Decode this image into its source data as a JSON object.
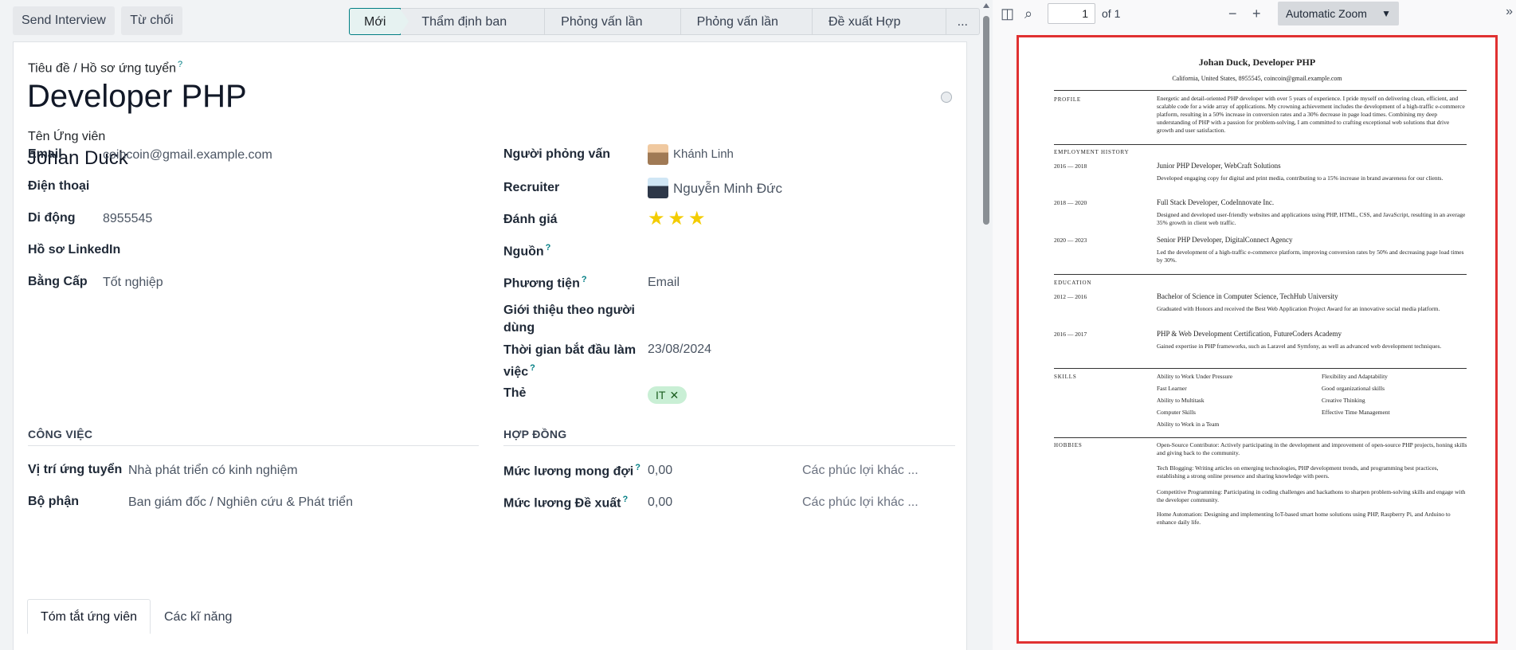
{
  "toolbar": {
    "send_interview": "Send Interview",
    "refuse": "Từ chối"
  },
  "stages": [
    "Mới",
    "Thẩm định ban đầu",
    "Phỏng vấn lần đầu",
    "Phỏng vấn lần hai",
    "Đề xuất Hợp đồng",
    "..."
  ],
  "form": {
    "title_label": "Tiêu đề / Hồ sơ ứng tuyển",
    "job_title": "Developer PHP",
    "candidate_label": "Tên Ứng viên",
    "candidate_name": "Johan Duck",
    "left_fields": [
      {
        "label": "Email",
        "value": "coincoin@gmail.example.com"
      },
      {
        "label": "Điện thoại",
        "value": ""
      },
      {
        "label": "Di động",
        "value": "8955545"
      },
      {
        "label": "Hồ sơ LinkedIn",
        "value": ""
      },
      {
        "label": "Bằng Cấp",
        "value": "Tốt nghiệp"
      }
    ],
    "interviewer_label": "Người phỏng vấn",
    "interviewer": "Khánh Linh",
    "recruiter_label": "Recruiter",
    "recruiter": "Nguyễn Minh Đức",
    "rating_label": "Đánh giá",
    "rating": 3,
    "source_label": "Nguồn",
    "medium_label": "Phương tiện",
    "medium": "Email",
    "referral_label_1": "Giới thiệu theo người",
    "referral_label_2": "dùng",
    "start_label_1": "Thời gian bắt đầu làm",
    "start_label_2": "việc",
    "start_date": "23/08/2024",
    "tags_label": "Thẻ",
    "tag": "IT",
    "job_section": "CÔNG VIỆC",
    "position_label": "Vị trí ứng tuyển",
    "position": "Nhà phát triển có kinh nghiệm",
    "department_label": "Bộ phận",
    "department": "Ban giám đốc / Nghiên cứu & Phát triển",
    "contract_section": "HỢP ĐỒNG",
    "expected_label": "Mức lương mong đợi",
    "expected": "0,00",
    "proposed_label": "Mức lương Đề xuất",
    "proposed": "0,00",
    "benefits_placeholder": "Các phúc lợi khác ..."
  },
  "tabs": [
    "Tóm tắt ứng viên",
    "Các kĩ năng"
  ],
  "pdf": {
    "page": "1",
    "of": "of 1",
    "zoom": "Automatic Zoom",
    "name": "Johan Duck, Developer PHP",
    "contact": "California, United States, 8955545, coincoin@gmail.example.com",
    "profile_h": "PROFILE",
    "profile_text": "Energetic and detail-oriented PHP developer with over 5 years of experience. I pride myself on delivering clean, efficient, and scalable code for a wide array of applications. My crowning achievement includes the development of a high-traffic e-commerce platform, resulting in a 50% increase in conversion rates and a 30% decrease in page load times. Combining my deep understanding of PHP with a passion for problem-solving, I am committed to crafting exceptional web solutions that drive growth and user satisfaction.",
    "employment_h": "EMPLOYMENT HISTORY",
    "jobs": [
      {
        "date": "2016 — 2018",
        "title": "Junior PHP Developer, WebCraft Solutions",
        "desc": "Developed engaging copy for digital and print media, contributing to a 15% increase in brand awareness for our clients."
      },
      {
        "date": "2018 — 2020",
        "title": "Full Stack Developer, CodeInnovate Inc.",
        "desc": "Designed and developed user-friendly websites and applications using PHP, HTML, CSS, and JavaScript, resulting in an average 35% growth in client web traffic."
      },
      {
        "date": "2020 — 2023",
        "title": "Senior PHP Developer, DigitalConnect Agency",
        "desc": "Led the development of a high-traffic e-commerce platform, improving conversion rates by 50% and decreasing page load times by 30%."
      }
    ],
    "education_h": "EDUCATION",
    "education": [
      {
        "date": "2012 — 2016",
        "title": "Bachelor of Science in Computer Science, TechHub University",
        "desc": "Graduated with Honors and received the Best Web Application Project Award for an innovative social media platform."
      },
      {
        "date": "2016 — 2017",
        "title": "PHP & Web Development Certification, FutureCoders Academy",
        "desc": "Gained expertise in PHP frameworks, such as Laravel and Symfony, as well as advanced web development techniques."
      }
    ],
    "skills_h": "SKILLS",
    "skills_left": [
      "Ability to Work Under Pressure",
      "Fast Learner",
      "Ability to Multitask",
      "Computer Skills",
      "Ability to Work in a Team"
    ],
    "skills_right": [
      "Flexibility and Adaptability",
      "Good organizational skills",
      "Creative Thinking",
      "Effective Time Management"
    ],
    "hobbies_h": "HOBBIES",
    "hobbies": [
      "Open-Source Contributor: Actively participating in the development and improvement of open-source PHP projects, honing skills and giving back to the community.",
      "Tech Blogging: Writing articles on emerging technologies, PHP development trends, and programming best practices, establishing a strong online presence and sharing knowledge with peers.",
      "Competitive Programming: Participating in coding challenges and hackathons to sharpen problem-solving skills and engage with the developer community.",
      "Home Automation: Designing and implementing IoT-based smart home solutions using PHP, Raspberry Pi, and Arduino to enhance daily life."
    ]
  },
  "colors": {
    "accent": "#017e84",
    "star": "#f3cc00",
    "pdf_border": "#e03131",
    "tag_bg": "#c9efd5"
  }
}
